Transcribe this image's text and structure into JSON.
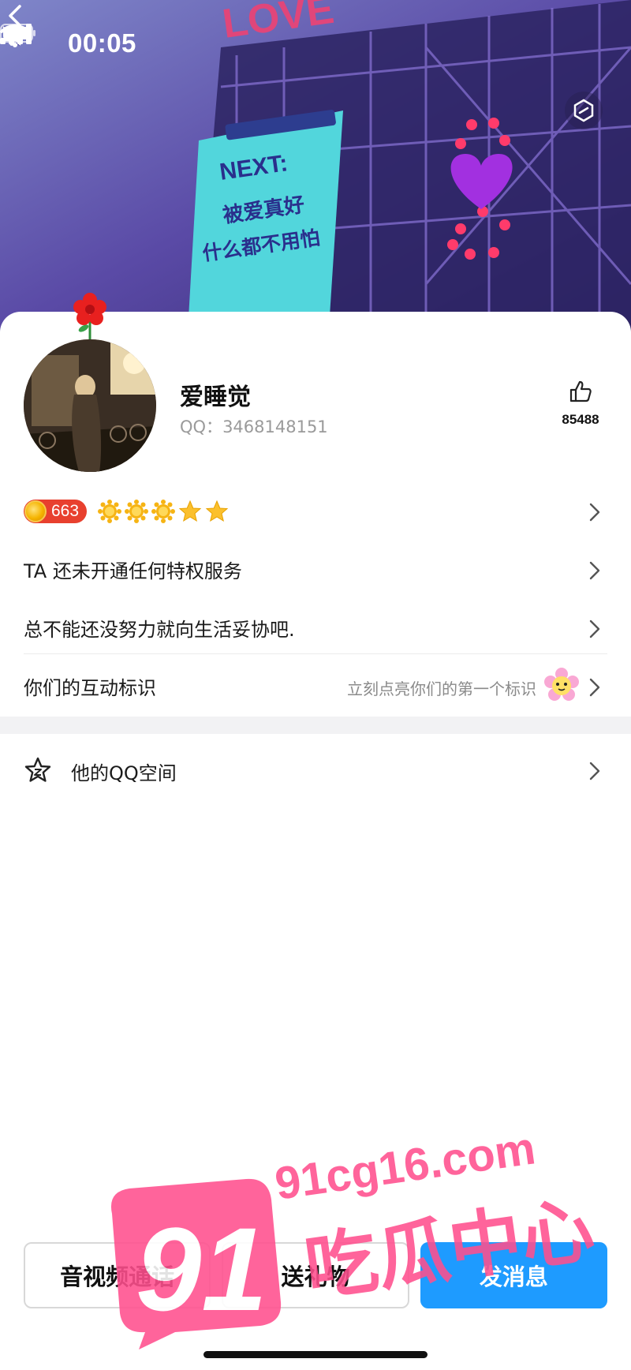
{
  "status_bar": {
    "time": "00:05"
  },
  "cover": {
    "sign_line1": "NEXT:",
    "sign_line2": "被爱真好",
    "sign_line3": "什么都不用怕",
    "top_text": "LOVE"
  },
  "profile": {
    "name": "爱睡觉",
    "qq_label": "QQ：",
    "qq_number": "3468148151",
    "likes": "85488",
    "level": "663"
  },
  "rows": {
    "privilege": "TA 还未开通任何特权服务",
    "signature": "总不能还没努力就向生活妥协吧.",
    "interaction": "你们的互动标识",
    "interaction_hint": "立刻点亮你们的第一个标识"
  },
  "qzone": {
    "label": "他的QQ空间"
  },
  "actions": {
    "call": "音视频通话",
    "gift": "送礼物",
    "message": "发消息"
  },
  "watermark": {
    "number": "91",
    "domain": "91cg16.com",
    "name": "吃瓜中心"
  },
  "colors": {
    "primary": "#1e9bff",
    "level_badge": "#e8402e",
    "watermark": "#ff4f8e"
  }
}
